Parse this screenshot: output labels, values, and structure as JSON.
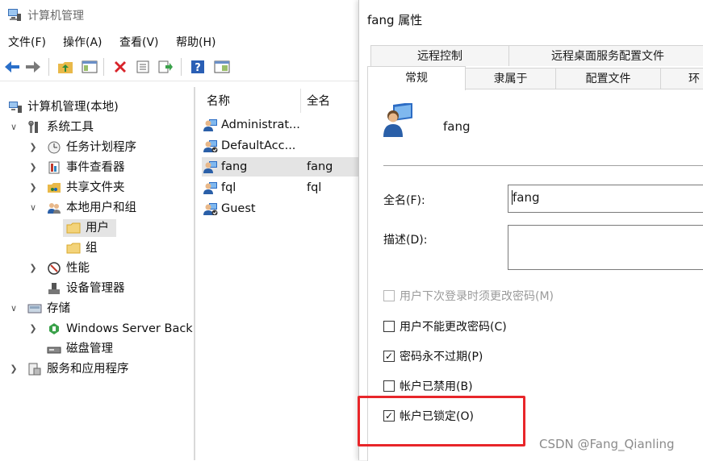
{
  "main_window": {
    "title": "计算机管理",
    "menu": [
      "文件(F)",
      "操作(A)",
      "查看(V)",
      "帮助(H)"
    ],
    "toolbar_icons": [
      "back-arrow-icon",
      "forward-arrow-icon",
      "up-folder-icon",
      "show-hide-tree-icon",
      "delete-icon",
      "properties-icon",
      "export-icon",
      "help-icon",
      "view-icon"
    ]
  },
  "tree": {
    "items": [
      {
        "label": "计算机管理(本地)",
        "icon": "computer-management-icon",
        "level": 0,
        "expand": ""
      },
      {
        "label": "系统工具",
        "icon": "tools-icon",
        "level": 1,
        "expand": "open"
      },
      {
        "label": "任务计划程序",
        "icon": "clock-icon",
        "level": 2,
        "expand": "closed"
      },
      {
        "label": "事件查看器",
        "icon": "event-viewer-icon",
        "level": 2,
        "expand": "closed"
      },
      {
        "label": "共享文件夹",
        "icon": "shared-folder-icon",
        "level": 2,
        "expand": "closed"
      },
      {
        "label": "本地用户和组",
        "icon": "users-groups-icon",
        "level": 2,
        "expand": "open"
      },
      {
        "label": "用户",
        "icon": "folder-icon",
        "level": 3,
        "expand": "",
        "selected": true
      },
      {
        "label": "组",
        "icon": "folder-icon",
        "level": 3,
        "expand": ""
      },
      {
        "label": "性能",
        "icon": "performance-icon",
        "level": 2,
        "expand": "closed"
      },
      {
        "label": "设备管理器",
        "icon": "device-manager-icon",
        "level": 2,
        "expand": ""
      },
      {
        "label": "存储",
        "icon": "storage-icon",
        "level": 1,
        "expand": "open"
      },
      {
        "label": "Windows Server Back",
        "icon": "backup-icon",
        "level": 2,
        "expand": "closed"
      },
      {
        "label": "磁盘管理",
        "icon": "disk-icon",
        "level": 2,
        "expand": ""
      },
      {
        "label": "服务和应用程序",
        "icon": "services-icon",
        "level": 1,
        "expand": "closed"
      }
    ]
  },
  "list": {
    "columns": [
      "名称",
      "全名"
    ],
    "rows": [
      {
        "name": "Administrat...",
        "fullname": "",
        "disabled_badge": false
      },
      {
        "name": "DefaultAcc...",
        "fullname": "",
        "disabled_badge": true
      },
      {
        "name": "fang",
        "fullname": "fang",
        "disabled_badge": false,
        "selected": true
      },
      {
        "name": "fql",
        "fullname": "fql",
        "disabled_badge": false
      },
      {
        "name": "Guest",
        "fullname": "",
        "disabled_badge": true
      }
    ]
  },
  "dialog": {
    "title": "fang 属性",
    "tabs_row1": [
      "远程控制",
      "远程桌面服务配置文件"
    ],
    "tabs_row2": [
      "常规",
      "隶属于",
      "配置文件",
      "环"
    ],
    "active_tab": "常规",
    "username": "fang",
    "fullname_label": "全名(F):",
    "fullname_value": "fang",
    "description_label": "描述(D):",
    "description_value": "",
    "checkboxes": [
      {
        "label": "用户下次登录时须更改密码(M)",
        "checked": false,
        "disabled": true
      },
      {
        "label": "用户不能更改密码(C)",
        "checked": false,
        "disabled": false
      },
      {
        "label": "密码永不过期(P)",
        "checked": true,
        "disabled": false
      },
      {
        "label": "帐户已禁用(B)",
        "checked": false,
        "disabled": false
      },
      {
        "label": "帐户已锁定(O)",
        "checked": true,
        "disabled": false
      }
    ]
  },
  "watermark": "CSDN @Fang_Qianling",
  "colors": {
    "highlight_box": "#e8262a",
    "selection": "#e4e4e4"
  }
}
